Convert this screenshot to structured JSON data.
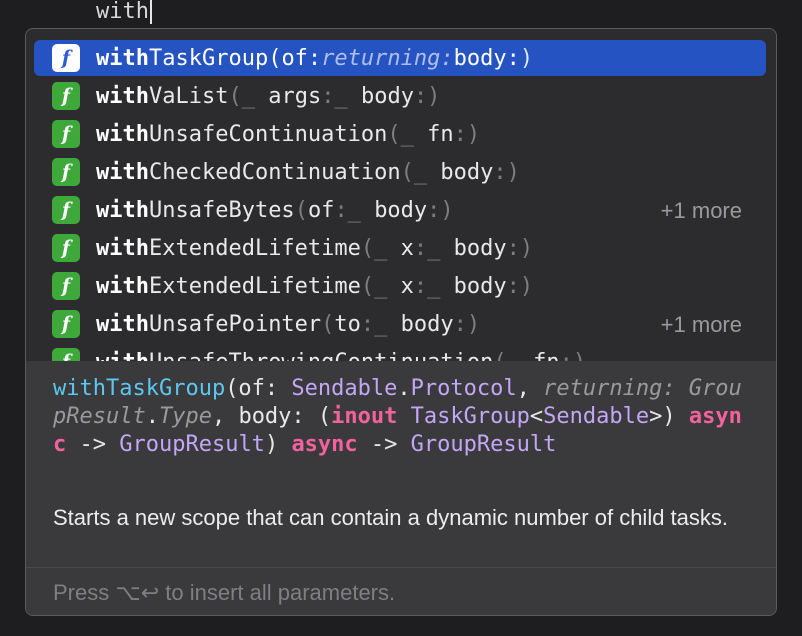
{
  "editor": {
    "typed_text": "with"
  },
  "completions": [
    {
      "badge": "f",
      "prefix": "with",
      "segments": [
        [
          "name",
          "TaskGroup("
        ],
        [
          "lbl",
          "of:"
        ],
        [
          "it",
          "returning:"
        ],
        [
          "lbl",
          "body:"
        ],
        [
          "p",
          ")"
        ]
      ],
      "more": ""
    },
    {
      "badge": "f",
      "prefix": "with",
      "segments": [
        [
          "name",
          "VaList"
        ],
        [
          "p",
          "(_ "
        ],
        [
          "lbl",
          "args"
        ],
        [
          "p",
          ":_ "
        ],
        [
          "lbl",
          "body"
        ],
        [
          "p",
          ":)"
        ]
      ],
      "more": ""
    },
    {
      "badge": "f",
      "prefix": "with",
      "segments": [
        [
          "name",
          "UnsafeContinuation"
        ],
        [
          "p",
          "(_ "
        ],
        [
          "lbl",
          "fn"
        ],
        [
          "p",
          ":)"
        ]
      ],
      "more": ""
    },
    {
      "badge": "f",
      "prefix": "with",
      "segments": [
        [
          "name",
          "CheckedContinuation"
        ],
        [
          "p",
          "(_ "
        ],
        [
          "lbl",
          "body"
        ],
        [
          "p",
          ":)"
        ]
      ],
      "more": ""
    },
    {
      "badge": "f",
      "prefix": "with",
      "segments": [
        [
          "name",
          "UnsafeBytes"
        ],
        [
          "p",
          "("
        ],
        [
          "lbl",
          "of"
        ],
        [
          "p",
          ":_ "
        ],
        [
          "lbl",
          "body"
        ],
        [
          "p",
          ":)"
        ]
      ],
      "more": "+1 more"
    },
    {
      "badge": "f",
      "prefix": "with",
      "segments": [
        [
          "name",
          "ExtendedLifetime"
        ],
        [
          "p",
          "(_ "
        ],
        [
          "lbl",
          "x"
        ],
        [
          "p",
          ":_ "
        ],
        [
          "lbl",
          "body"
        ],
        [
          "p",
          ":)"
        ]
      ],
      "more": ""
    },
    {
      "badge": "f",
      "prefix": "with",
      "segments": [
        [
          "name",
          "ExtendedLifetime"
        ],
        [
          "p",
          "(_ "
        ],
        [
          "lbl",
          "x"
        ],
        [
          "p",
          ":_ "
        ],
        [
          "lbl",
          "body"
        ],
        [
          "p",
          ":)"
        ]
      ],
      "more": ""
    },
    {
      "badge": "f",
      "prefix": "with",
      "segments": [
        [
          "name",
          "UnsafePointer"
        ],
        [
          "p",
          "("
        ],
        [
          "lbl",
          "to"
        ],
        [
          "p",
          ":_ "
        ],
        [
          "lbl",
          "body"
        ],
        [
          "p",
          ":)"
        ]
      ],
      "more": "+1 more"
    },
    {
      "badge": "f",
      "prefix": "with",
      "segments": [
        [
          "name",
          "UnsafeThrowingContinuation"
        ],
        [
          "p",
          "(_ "
        ],
        [
          "lbl",
          "fn"
        ],
        [
          "p",
          ":)"
        ]
      ],
      "more": ""
    }
  ],
  "declaration": [
    [
      "blue",
      "withTaskGroup"
    ],
    [
      "plain",
      "(of: "
    ],
    [
      "pur",
      "Sendable"
    ],
    [
      "plain",
      "."
    ],
    [
      "pur",
      "Protocol"
    ],
    [
      "plain",
      ", "
    ],
    [
      "gray-it",
      "returning: GroupResult"
    ],
    [
      "plain",
      "."
    ],
    [
      "gray-it",
      "Type"
    ],
    [
      "plain",
      ", body: ("
    ],
    [
      "pink",
      "inout"
    ],
    [
      "plain",
      " "
    ],
    [
      "pur",
      "TaskGroup"
    ],
    [
      "plain",
      "<"
    ],
    [
      "pur",
      "Sendable"
    ],
    [
      "plain",
      ">) "
    ],
    [
      "pink",
      "async"
    ],
    [
      "plain",
      " -> "
    ],
    [
      "pur",
      "GroupResult"
    ],
    [
      "plain",
      ") "
    ],
    [
      "pink",
      "async"
    ],
    [
      "plain",
      " -> "
    ],
    [
      "pur",
      "GroupResult"
    ]
  ],
  "description": "Starts a new scope that can contain a dynamic number of child tasks.",
  "footer_hint": "Press ⌥↩ to insert all parameters."
}
